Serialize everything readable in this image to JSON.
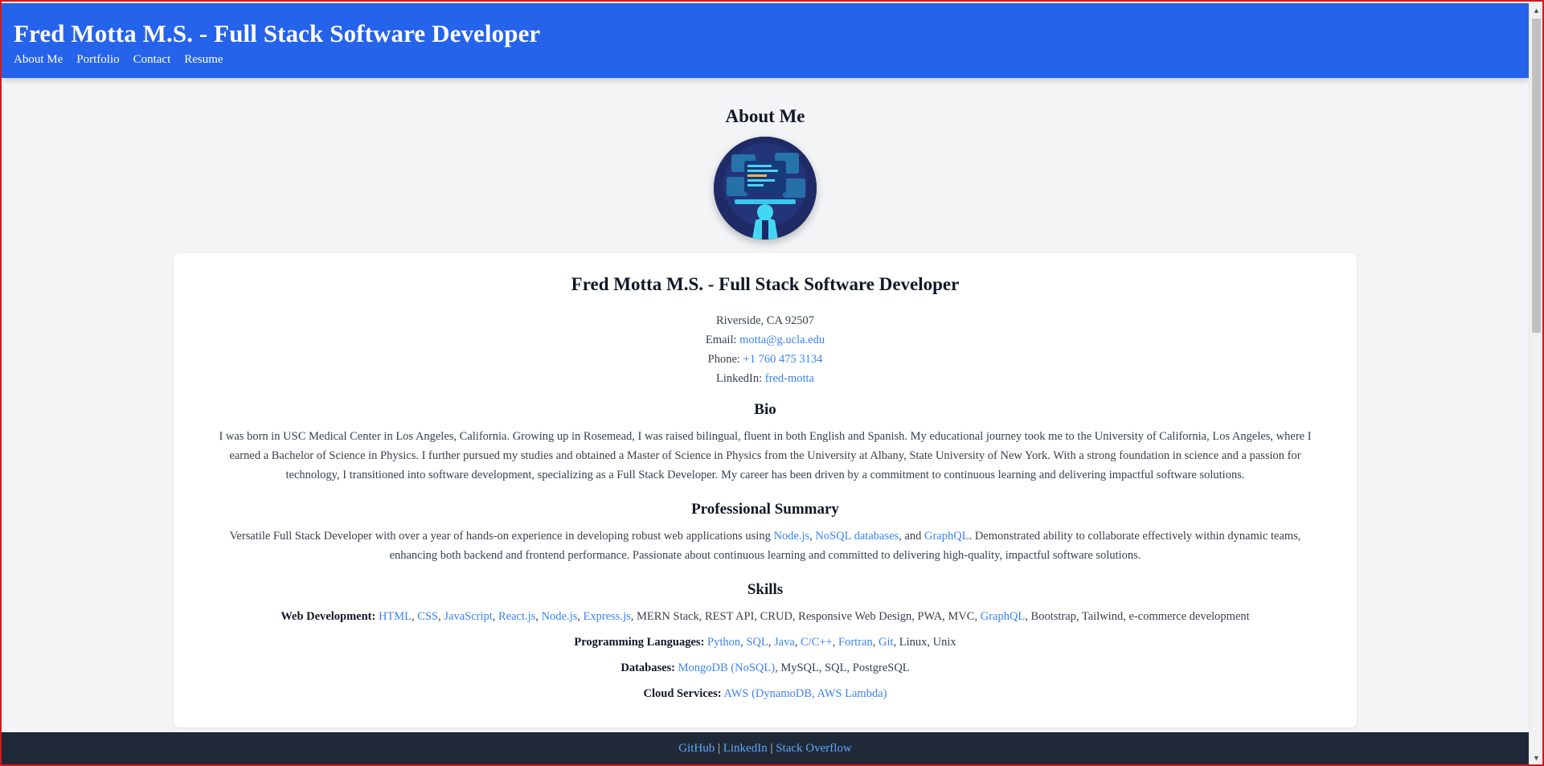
{
  "header": {
    "title": "Fred Motta M.S. - Full Stack Software Developer",
    "nav": [
      "About Me",
      "Portfolio",
      "Contact",
      "Resume"
    ]
  },
  "about": {
    "heading": "About Me",
    "avatar_icon": "developer-at-computer-illustration"
  },
  "card": {
    "name": "Fred Motta M.S. - Full Stack Software Developer",
    "location": "Riverside, CA 92507",
    "email_label": "Email:",
    "email": "motta@g.ucla.edu",
    "phone_label": "Phone:",
    "phone": "+1 760 475 3134",
    "linkedin_label": "LinkedIn:",
    "linkedin": "fred-motta",
    "bio_heading": "Bio",
    "bio": "I was born in USC Medical Center in Los Angeles, California. Growing up in Rosemead, I was raised bilingual, fluent in both English and Spanish. My educational journey took me to the University of California, Los Angeles, where I earned a Bachelor of Science in Physics. I further pursued my studies and obtained a Master of Science in Physics from the University at Albany, State University of New York. With a strong foundation in science and a passion for technology, I transitioned into software development, specializing as a Full Stack Developer. My career has been driven by a commitment to continuous learning and delivering impactful software solutions.",
    "summary_heading": "Professional Summary",
    "summary_before": "Versatile Full Stack Developer with over a year of hands-on experience in developing robust web applications using ",
    "summary_links": [
      "Node.js",
      "NoSQL databases",
      "GraphQL"
    ],
    "summary_sep1": ", ",
    "summary_sep2": ", and ",
    "summary_after": ". Demonstrated ability to collaborate effectively within dynamic teams, enhancing both backend and frontend performance. Passionate about continuous learning and committed to delivering high-quality, impactful software solutions.",
    "skills_heading": "Skills",
    "skills": {
      "web_label": "Web Development:",
      "web_links": [
        "HTML",
        "CSS",
        "JavaScript",
        "React.js",
        "Node.js",
        "Express.js"
      ],
      "web_plain": ", MERN Stack, REST API, CRUD, Responsive Web Design, PWA, MVC, ",
      "web_link_last": "GraphQL",
      "web_tail": ", Bootstrap, Tailwind, e-commerce development",
      "prog_label": "Programming Languages:",
      "prog_links": [
        "Python",
        "SQL",
        "Java",
        "C/C++",
        "Fortran",
        "Git"
      ],
      "prog_tail": ", Linux, Unix",
      "db_label": "Databases:",
      "db_link": "MongoDB (NoSQL)",
      "db_tail": ", MySQL, SQL, PostgreSQL",
      "cloud_label": "Cloud Services:",
      "cloud_link": "AWS (DynamoDB, AWS Lambda)"
    }
  },
  "footer": {
    "links": [
      "GitHub",
      "LinkedIn",
      "Stack Overflow"
    ],
    "separator": " | "
  },
  "colors": {
    "header_bg": "#2563eb",
    "link": "#3b82f6",
    "footer_bg": "#1f2937",
    "page_bg": "#f3f4f6"
  }
}
